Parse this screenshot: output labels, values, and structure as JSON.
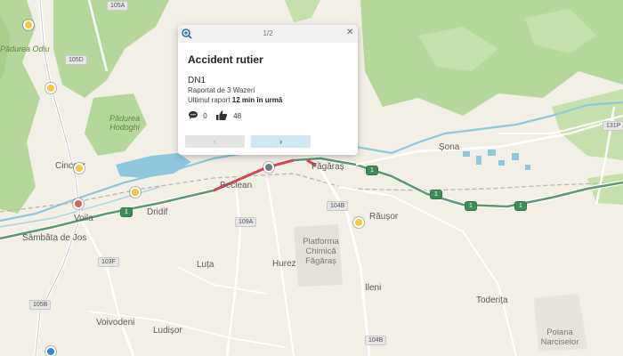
{
  "popup": {
    "pager": "1/2",
    "close_icon": "close-icon",
    "zoom_icon": "zoom-in-icon",
    "title": "Accident rutier",
    "street": "DN1",
    "reported_by": "Raportat de 3 Wazeri",
    "last_report_prefix": "Ultimul raport ",
    "last_report_time": "12 min în urmă",
    "comments_count": "0",
    "thumbs_count": "48",
    "prev_label": "‹",
    "next_label": "›"
  },
  "places": {
    "sambata_de_sus": "Sâmbăta de Jos",
    "odiu": "Pădurea Odiu",
    "hodoghi": "Pădurea Hodoghi",
    "cincsor": "Cincșor",
    "voila": "Voila",
    "dridif": "Dridif",
    "beclean": "Beclean",
    "fagaras": "Făgăraș",
    "sona": "Șona",
    "rausor": "Răușor",
    "platforma": "Platforma Chimică Făgăraș",
    "luta": "Luța",
    "hurez": "Hurez",
    "ileni": "Ileni",
    "toderita": "Toderița",
    "voivodeni": "Voivodeni",
    "ludisor": "Ludișor",
    "poiana": "Poiana Narciselor"
  },
  "roads": {
    "r105a": "105A",
    "r105d": "105D",
    "r105b": "105B",
    "r103f": "103F",
    "r109a": "109A",
    "r104b_north": "104B",
    "r104b_south": "104B",
    "r131p": "131P",
    "dn1_a": "1",
    "dn1_b": "1",
    "dn1_c": "1",
    "dn1_d": "1",
    "dn1_e": "1"
  },
  "colors": {
    "accent": "#2b8be0",
    "traffic": "#d44b4b",
    "main_road": "#5e9a6e"
  }
}
